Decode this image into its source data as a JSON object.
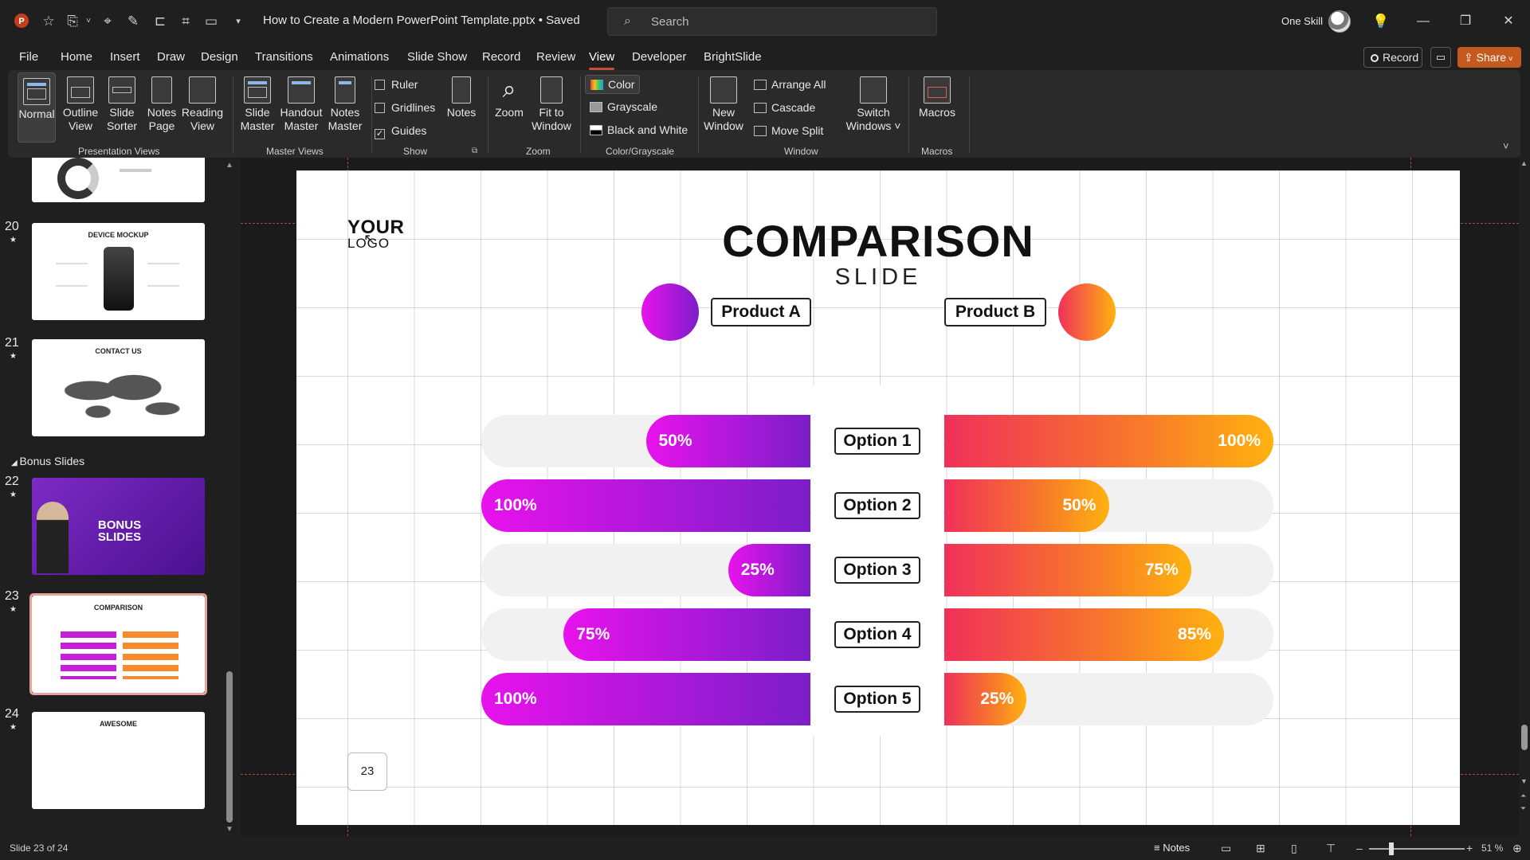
{
  "window": {
    "doc_title": "How to Create a Modern PowerPoint Template.pptx • Saved",
    "search_placeholder": "Search",
    "user_name": "One Skill",
    "minimize": "—",
    "restore": "❐",
    "close": "✕"
  },
  "menu": {
    "items": [
      "File",
      "Home",
      "Insert",
      "Draw",
      "Design",
      "Transitions",
      "Animations",
      "Slide Show",
      "Record",
      "Review",
      "View",
      "Developer",
      "BrightSlide"
    ],
    "active": "View",
    "record_label": "Record",
    "share_label": "Share"
  },
  "ribbon": {
    "presentation_views": {
      "label": "Presentation Views",
      "buttons": [
        {
          "line1": "Normal",
          "line2": ""
        },
        {
          "line1": "Outline",
          "line2": "View"
        },
        {
          "line1": "Slide",
          "line2": "Sorter"
        },
        {
          "line1": "Notes",
          "line2": "Page"
        },
        {
          "line1": "Reading",
          "line2": "View"
        }
      ]
    },
    "master_views": {
      "label": "Master Views",
      "buttons": [
        {
          "line1": "Slide",
          "line2": "Master"
        },
        {
          "line1": "Handout",
          "line2": "Master"
        },
        {
          "line1": "Notes",
          "line2": "Master"
        }
      ]
    },
    "show": {
      "label": "Show",
      "ruler": "Ruler",
      "gridlines": "Gridlines",
      "guides": "Guides",
      "notes": "Notes"
    },
    "zoom": {
      "label": "Zoom",
      "zoom_btn": "Zoom",
      "fit_line1": "Fit to",
      "fit_line2": "Window"
    },
    "color": {
      "label": "Color/Grayscale",
      "color": "Color",
      "grayscale": "Grayscale",
      "bw": "Black and White"
    },
    "window": {
      "label": "Window",
      "new_line1": "New",
      "new_line2": "Window",
      "arrange": "Arrange All",
      "cascade": "Cascade",
      "move_split": "Move Split",
      "switch_line1": "Switch",
      "switch_line2": "Windows ˅"
    },
    "macros": {
      "label": "Macros",
      "btn": "Macros"
    }
  },
  "thumbnails": [
    {
      "num": "20",
      "title": "DEVICE MOCKUP"
    },
    {
      "num": "21",
      "title": "CONTACT US"
    },
    {
      "num": "22",
      "title": "BONUS SLIDES"
    },
    {
      "num": "23",
      "title": "COMPARISON"
    },
    {
      "num": "24",
      "title": "AWESOME"
    }
  ],
  "section_label": "Bonus Slides",
  "slide": {
    "logo_line1": "YOUR",
    "logo_line2": "LOGO",
    "title": "COMPARISON",
    "subtitle": "SLIDE",
    "product_a": "Product A",
    "product_b": "Product B",
    "page_number": "23",
    "colors": {
      "product_a_start": "#e812ec",
      "product_a_end": "#7b1ec8",
      "product_b_start": "#f0305a",
      "product_b_end": "#ffb20f"
    }
  },
  "chart_data": {
    "type": "bar",
    "categories": [
      "Option 1",
      "Option 2",
      "Option 3",
      "Option 4",
      "Option 5"
    ],
    "series": [
      {
        "name": "Product A",
        "values": [
          50,
          100,
          25,
          75,
          100
        ],
        "labels": [
          "50%",
          "100%",
          "25%",
          "75%",
          "100%"
        ]
      },
      {
        "name": "Product B",
        "values": [
          100,
          50,
          75,
          85,
          25
        ],
        "labels": [
          "100%",
          "50%",
          "75%",
          "85%",
          "25%"
        ]
      }
    ],
    "ylim": [
      0,
      100
    ]
  },
  "status": {
    "slide_count": "Slide 23 of 24",
    "notes": "Notes",
    "zoom": "51 %"
  }
}
